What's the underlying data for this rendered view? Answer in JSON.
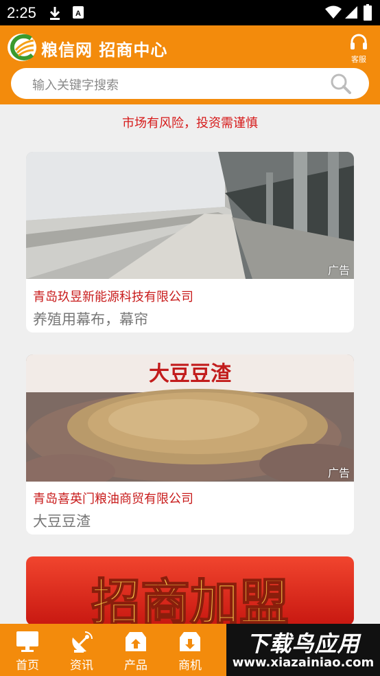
{
  "status_bar": {
    "time": "2:25"
  },
  "header": {
    "title": "粮信网 招商中心",
    "service_label": "客服",
    "search_placeholder": "输入关键字搜索"
  },
  "notice": "市场有风险，投资需谨慎",
  "listings": [
    {
      "company": "青岛玖昱新能源科技有限公司",
      "product": "养殖用幕布，幕帘",
      "badge": "广告"
    },
    {
      "company": "青岛喜英门粮油商贸有限公司",
      "product": "大豆豆渣",
      "badge": "广告",
      "image_text": "大豆豆渣"
    },
    {
      "image_text": "招商加盟"
    }
  ],
  "bottom_nav": [
    {
      "label": "首页",
      "icon": "monitor-icon"
    },
    {
      "label": "资讯",
      "icon": "satellite-dish-icon"
    },
    {
      "label": "产品",
      "icon": "box-up-icon"
    },
    {
      "label": "商机",
      "icon": "box-down-icon"
    }
  ],
  "watermark": {
    "line1": "下载鸟应用",
    "line2": "www.xiazainiao.com"
  },
  "colors": {
    "brand_orange": "#f38b0c",
    "notice_red": "#d61a1a",
    "company_red": "#c81b1b"
  }
}
